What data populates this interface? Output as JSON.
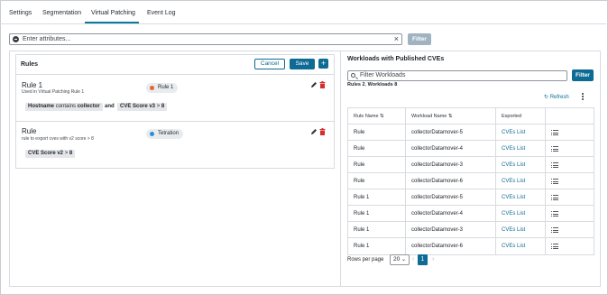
{
  "tabs": [
    {
      "label": "Settings"
    },
    {
      "label": "Segmentation"
    },
    {
      "label": "Virtual Patching"
    },
    {
      "label": "Event Log"
    }
  ],
  "active_tab": "Virtual Patching",
  "filter_bar": {
    "placeholder": "Enter attributes...",
    "clear_glyph": "×",
    "button_label": "Filter"
  },
  "rules_panel": {
    "title": "Rules",
    "cancel_label": "Cancel",
    "save_label": "Save",
    "add_glyph": "+",
    "rules": [
      {
        "name": "Rule 1",
        "description": "Used in Virtual Patching Rule 1",
        "tag": "Rule 1",
        "tag_color": "#e8633a",
        "conditions": [
          {
            "key": "Hostname",
            "op": "contains",
            "value": "collector"
          },
          {
            "key": "CVE Score v3",
            "op": ">",
            "value": "8"
          }
        ],
        "joiner": "and"
      },
      {
        "name": "Rule",
        "description": "rule to export cves with v2 score > 8",
        "tag": "Tetration",
        "tag_color": "#2b8fd6",
        "conditions": [
          {
            "key": "CVE Score v2",
            "op": ">",
            "value": "8"
          }
        ]
      }
    ]
  },
  "workloads_panel": {
    "title": "Workloads with Published CVEs",
    "search_placeholder": "Filter Workloads",
    "filter_label": "Filter",
    "counts_prefix_rules": "Rules",
    "rules_count": "2",
    "counts_prefix_workloads": "Workloads",
    "workloads_count": "8",
    "refresh_label": "Refresh",
    "columns": [
      "Rule Name",
      "Workload Name",
      "Exported"
    ],
    "rows": [
      {
        "rule": "Rule",
        "workload": "collectorDatamover-5",
        "exported": "CVEs List"
      },
      {
        "rule": "Rule",
        "workload": "collectorDatamover-4",
        "exported": "CVEs List"
      },
      {
        "rule": "Rule",
        "workload": "collectorDatamover-3",
        "exported": "CVEs List"
      },
      {
        "rule": "Rule",
        "workload": "collectorDatamover-6",
        "exported": "CVEs List"
      },
      {
        "rule": "Rule 1",
        "workload": "collectorDatamover-5",
        "exported": "CVEs List"
      },
      {
        "rule": "Rule 1",
        "workload": "collectorDatamover-4",
        "exported": "CVEs List"
      },
      {
        "rule": "Rule 1",
        "workload": "collectorDatamover-3",
        "exported": "CVEs List"
      },
      {
        "rule": "Rule 1",
        "workload": "collectorDatamover-6",
        "exported": "CVEs List"
      }
    ],
    "rows_per_page_label": "Rows per page",
    "rows_per_page_value": "20",
    "current_page": "1"
  },
  "colors": {
    "accent": "#0d6b94",
    "filter_button": "#9fb3c1",
    "delete": "#d32f2f"
  }
}
